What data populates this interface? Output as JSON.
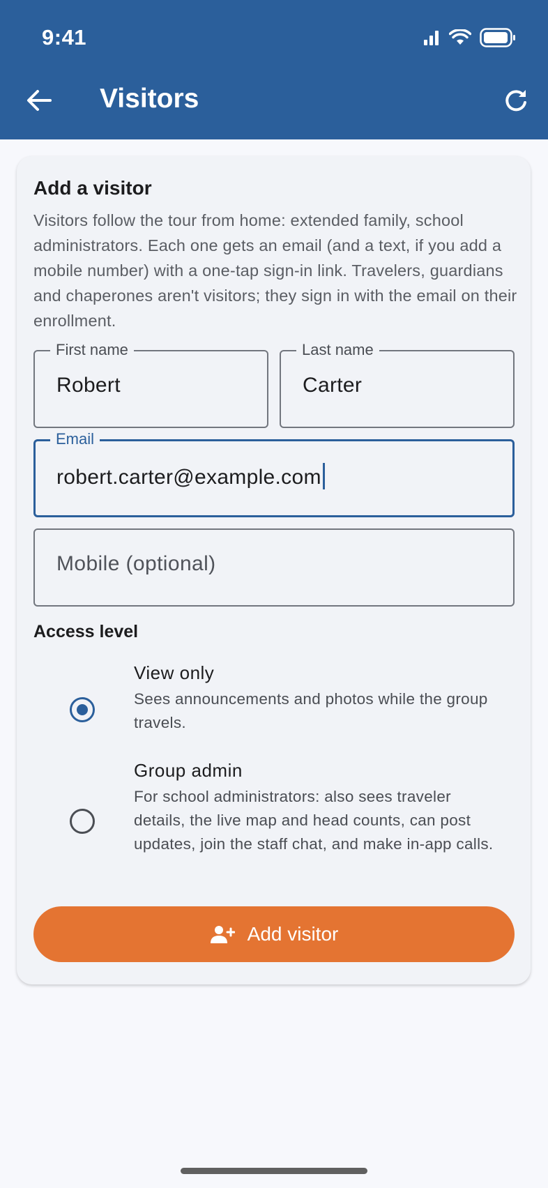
{
  "status": {
    "time": "9:41"
  },
  "appbar": {
    "title": "Visitors"
  },
  "card": {
    "title": "Add a visitor",
    "description": "Visitors follow the tour from home: extended family, school administrators. Each one gets an email (and a text, if you add a mobile number) with a one-tap sign-in link. Travelers, guardians and chaperones aren't visitors; they sign in with the email on their enrollment."
  },
  "form": {
    "first_name": {
      "label": "First name",
      "value": "Robert"
    },
    "last_name": {
      "label": "Last name",
      "value": "Carter"
    },
    "email": {
      "label": "Email",
      "value": "robert.carter@example.com"
    },
    "mobile": {
      "placeholder": "Mobile (optional)",
      "value": ""
    }
  },
  "access": {
    "label": "Access level",
    "options": [
      {
        "title": "View only",
        "desc": "Sees announcements and photos while the group travels.",
        "selected": true
      },
      {
        "title": "Group admin",
        "desc": "For school administrators: also sees traveler details, the live map and head counts, can post updates, join the staff chat, and make in-app calls.",
        "selected": false
      }
    ]
  },
  "add_button": {
    "label": "Add visitor",
    "icon": "person-add-icon"
  },
  "colors": {
    "primary": "#2b5f9b",
    "accent": "#e47432",
    "background": "#f7f8fc",
    "card": "#f1f3f7"
  }
}
